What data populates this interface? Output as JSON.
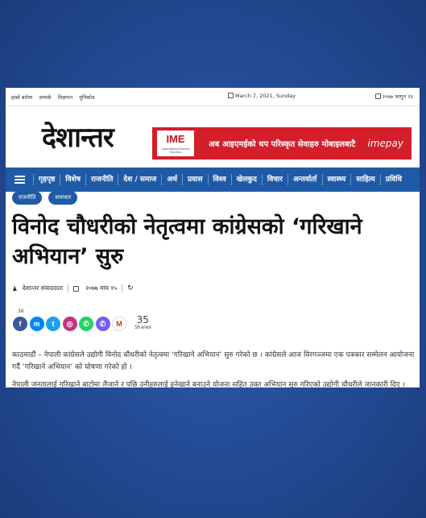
{
  "topbar": {
    "links": [
      "हाम्रो बारेमा",
      "सम्पर्क",
      "विज्ञापन",
      "युनिकोड"
    ],
    "date_en": "March 7, 2021, Sunday",
    "date_np": "२०७७ फागुन २३"
  },
  "header": {
    "logo": "देशान्तर",
    "ad": {
      "brand": "IME",
      "brand_sub": "International Money Express",
      "text": "अब आइएमईको थप परिस्कृत सेवाहरु मोबाइलबाटै",
      "logo_text": "imepay"
    }
  },
  "nav": {
    "items": [
      "गृहपृष्ठ",
      "विशेष",
      "राजनीति",
      "देश / समाज",
      "अर्थ",
      "प्रवास",
      "विश्व",
      "खेलकुद",
      "विचार",
      "अन्तर्वार्ता",
      "स्वास्थ्य",
      "साहित्य",
      "प्रविधि"
    ]
  },
  "article": {
    "tags": [
      "राजनीति",
      "समाचार"
    ],
    "title": "विनोद चौधरीको नेतृत्वमा कांग्रेसको ‘गरिखाने अभियान’ सुरु",
    "author": "देशान्तर संवाददाता",
    "date": "२०७७ माघ १५",
    "share_top_count": "36",
    "share_total": "35",
    "share_label": "Shares",
    "para1": "काठमाडौं – नेपाली कांग्रेसले उद्योगी विनोद चौधरीको नेतृत्वमा ‘गरिखाने अभियान’ सुरु गरेको छ । कांग्रेसले आज विरगञ्जमा एक पत्रकार सम्मेलन आयोजना गर्दै ‘गरिखाने अभियान’ को घोषणा गरेको हो ।",
    "para2": "नेपाली जनतालाई गरिखाने बाटोमा लैजाने र पछि उनीहरुलाई हुनेखाने बनाउने योजना सहित उक्त अभियान सुरु गरिएको उद्योगी चौधरीले जानकारी दिए । उनले नेपाली काँग्रेसका प्रत्येक कार्यकर्ता, नेविसंघ, तरुण दल, राज्य सञ्चालनका विभिन्न पंक्तिमा रहेका युवाहरुलाई"
  },
  "socials": [
    {
      "name": "facebook",
      "color": "#3b5998",
      "glyph": "f"
    },
    {
      "name": "messenger",
      "color": "#0084ff",
      "glyph": "m"
    },
    {
      "name": "twitter",
      "color": "#1da1f2",
      "glyph": "t"
    },
    {
      "name": "instagram",
      "color": "#c13584",
      "glyph": "◎"
    },
    {
      "name": "whatsapp",
      "color": "#25d366",
      "glyph": "✆"
    },
    {
      "name": "viber",
      "color": "#7360f2",
      "glyph": "✆"
    },
    {
      "name": "gmail",
      "color": "#ffffff",
      "glyph": "M"
    }
  ]
}
